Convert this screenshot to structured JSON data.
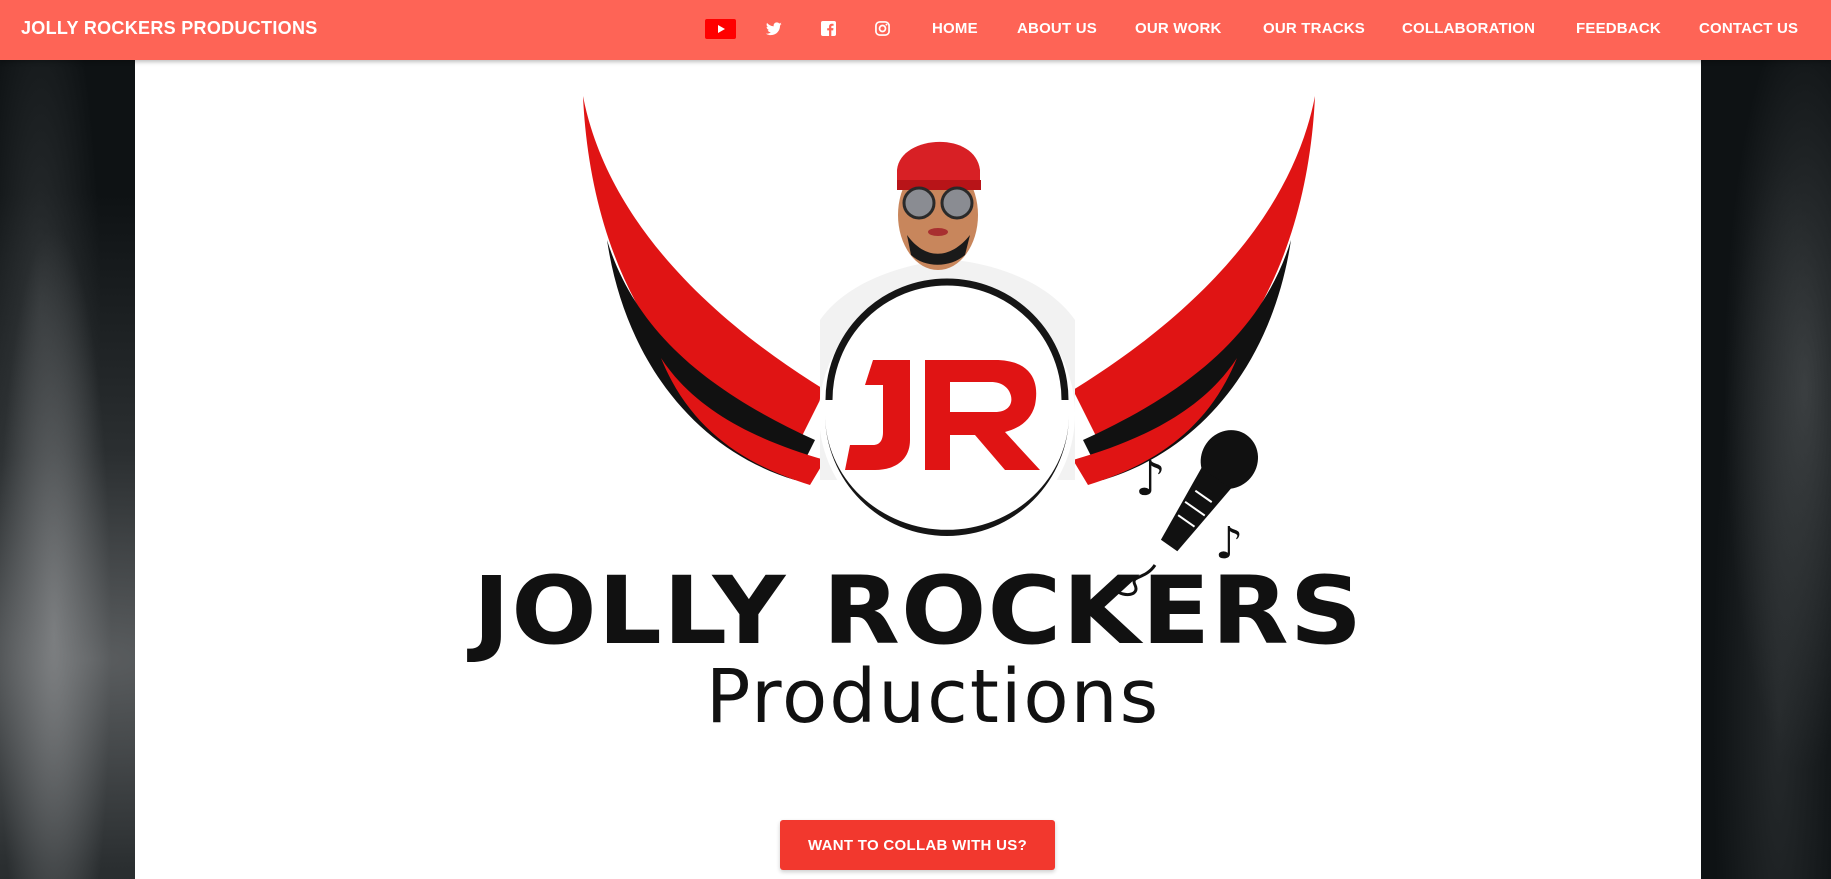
{
  "navbar": {
    "brand": "JOLLY ROCKERS PRODUCTIONS",
    "social_icons": [
      "youtube-icon",
      "twitter-icon",
      "facebook-icon",
      "instagram-icon"
    ],
    "links": [
      "HOME",
      "ABOUT US",
      "OUR WORK",
      "OUR TRACKS",
      "COLLABORATION",
      "FEEDBACK",
      "CONTACT US"
    ]
  },
  "hero": {
    "logo_monogram": "JR",
    "logo_line1": "JOLLY ROCKERS",
    "logo_line2": "Productions",
    "cta_label": "WANT TO COLLAB WITH US?"
  },
  "colors": {
    "navbar_bg": "#fe6456",
    "accent_red": "#e01414",
    "button_bg": "#f2382e"
  }
}
